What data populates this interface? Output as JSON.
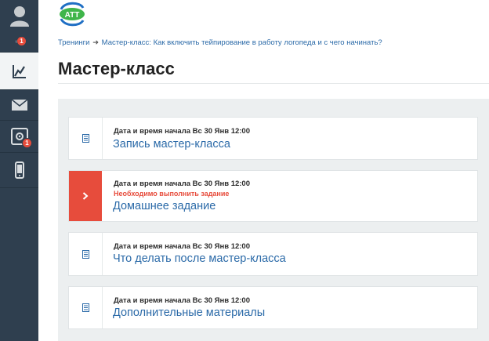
{
  "sidebar": {
    "items": [
      {
        "icon": "user-avatar-icon"
      },
      {
        "icon": "notifications-icon",
        "badge": "1"
      },
      {
        "icon": "chart-icon",
        "active": true
      },
      {
        "icon": "envelope-icon"
      },
      {
        "icon": "safe-icon",
        "badge": "1"
      },
      {
        "icon": "mobile-phone-icon"
      }
    ]
  },
  "logo": {
    "text": "ATT"
  },
  "breadcrumb": {
    "root": "Тренинги",
    "separator": "➜",
    "current": "Мастер-класс: Как включить тейпирование в работу логопеда и с чего начинать?"
  },
  "page_title": "Мастер-класс",
  "lessons": [
    {
      "start": "Дата и время начала Вс 30 Янв 12:00",
      "warning": "",
      "title": "Запись мастер-класса",
      "icon": "document-icon"
    },
    {
      "start": "Дата и время начала Вс 30 Янв 12:00",
      "warning": "Необходимо выполнить задание",
      "title": "Домашнее задание",
      "icon": "chevron-right-icon"
    },
    {
      "start": "Дата и время начала Вс 30 Янв 12:00",
      "warning": "",
      "title": "Что делать после мастер-класса",
      "icon": "document-icon"
    },
    {
      "start": "Дата и время начала Вс 30 Янв 12:00",
      "warning": "",
      "title": "Дополнительные материалы",
      "icon": "document-icon"
    }
  ],
  "colors": {
    "sidebar": "#2f3f4f",
    "accent": "#2b6aa8",
    "alert": "#e74c3c",
    "panel": "#eceff0"
  }
}
